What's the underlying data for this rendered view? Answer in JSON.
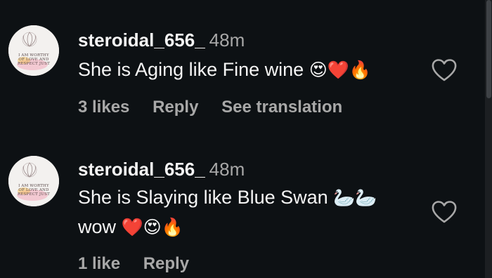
{
  "comments": [
    {
      "username": "steroidal_656_",
      "time": "48m",
      "text_lines": [
        "She is Aging like Fine wine"
      ],
      "emojis_line1": [
        "😍",
        "❤️",
        "🔥"
      ],
      "likes": "3 likes",
      "reply_label": "Reply",
      "translate_label": "See translation",
      "avatar_text": [
        "I AM WORTHY",
        "OF LOVE AND",
        "RESPECT JUST"
      ],
      "like_icon": "heart-outline-icon"
    },
    {
      "username": "steroidal_656_",
      "time": "48m",
      "text_lines": [
        "She is Slaying like Blue Swan",
        "wow"
      ],
      "emojis_line1": [
        "🦢",
        "🦢"
      ],
      "emojis_line2": [
        "❤️",
        "😍",
        "🔥"
      ],
      "likes": "1 like",
      "reply_label": "Reply",
      "avatar_text": [
        "I AM WORTHY",
        "OF LOVE AND",
        "RESPECT JUST"
      ],
      "like_icon": "heart-outline-icon"
    }
  ],
  "colors": {
    "background": "#0d1114",
    "primary_text": "#f5f5f5",
    "secondary_text": "#a8a8a8"
  }
}
